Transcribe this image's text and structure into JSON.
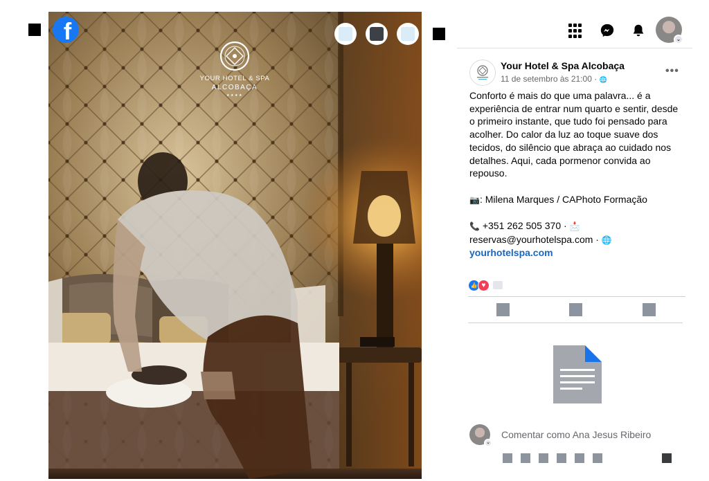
{
  "viewer": {
    "brand_logo_letter": "f",
    "photo": {
      "logo_line1": "YOUR HOTEL & SPA",
      "logo_line2": "ALCOBAÇA",
      "logo_stars": "★★★★"
    }
  },
  "topbar": {
    "icons": [
      "menu-grid-icon",
      "messenger-icon",
      "bell-icon",
      "account-avatar"
    ],
    "dropdown_glyph": "⌄"
  },
  "post": {
    "page_name": "Your Hotel & Spa Alcobaça",
    "date": "11 de setembro às 21:00 ·",
    "privacy_glyph": "🌐",
    "more_label": "•••",
    "paragraph1": "Conforto é mais do que uma palavra... é a experiência de entrar num quarto e sentir, desde o primeiro instante, que tudo foi pensado para acolher. Do calor da luz ao toque suave dos tecidos, do silêncio que abraça ao cuidado nos detalhes. Aqui, cada pormenor convida ao repouso.",
    "credit_emoji": "📷",
    "credit_text": ": Milena Marques / CAPhoto Formação",
    "phone_emoji": "📞",
    "phone_text": " +351 262 505 370 · ",
    "inbox_emoji": "📩",
    "email_text": "reservas@yourhotelspa.com · ",
    "globe_emoji": "🌐",
    "website": "yourhotelspa.com"
  },
  "reactions": {
    "like_glyph": "👍",
    "love_glyph": "♥"
  },
  "comment": {
    "placeholder": "Comentar como Ana Jesus Ribeiro",
    "dropdown_glyph": "⌄"
  },
  "colors": {
    "facebook_blue": "#1877f2",
    "link_blue": "#1468c2",
    "love_red": "#f33e58",
    "muted_text": "#65676b"
  }
}
